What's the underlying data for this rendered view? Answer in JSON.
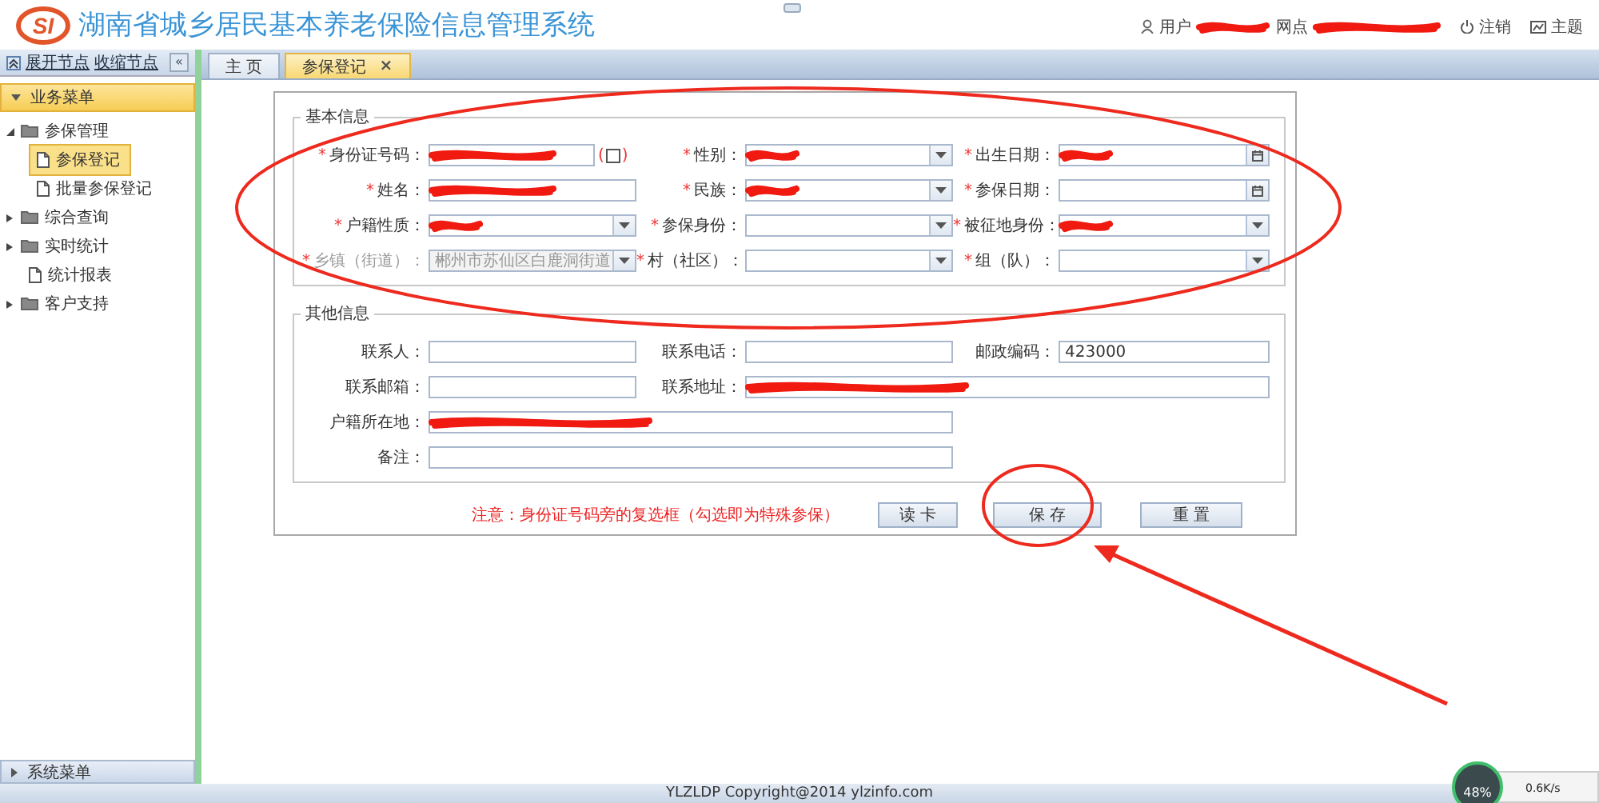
{
  "header": {
    "logo_text": "SI",
    "title": "湖南省城乡居民基本养老保险信息管理系统",
    "user_label": "用户",
    "user_redacted": true,
    "site_label": "网点",
    "site_redacted": true,
    "logout": "注销",
    "theme": "主题"
  },
  "sidebar": {
    "links": [
      "展开节点",
      "收缩节点"
    ],
    "collapse": "«",
    "section": "业务菜单",
    "tree": [
      {
        "label": "参保管理",
        "kind": "folder",
        "expanded": true,
        "children": [
          {
            "label": "参保登记",
            "kind": "page",
            "selected": true
          },
          {
            "label": "批量参保登记",
            "kind": "page",
            "selected": false
          }
        ]
      },
      {
        "label": "综合查询",
        "kind": "folder",
        "expanded": false
      },
      {
        "label": "实时统计",
        "kind": "folder",
        "expanded": false
      },
      {
        "label": "统计报表",
        "kind": "page",
        "selected": false
      },
      {
        "label": "客户支持",
        "kind": "folder",
        "expanded": false
      }
    ],
    "bottom": "系统菜单"
  },
  "tabs": [
    {
      "label": "主 页",
      "selected": false
    },
    {
      "label": "参保登记",
      "selected": true,
      "close": "×"
    }
  ],
  "sections": [
    {
      "legend": "基本信息",
      "rows": [
        [
          {
            "mark": "*",
            "label": "身份证号码：",
            "kind": "text",
            "redacted": true,
            "checkbox": {
              "open": "(",
              "close": ")",
              "checked": false
            }
          },
          {
            "mark": "*",
            "label": "性别：",
            "kind": "select",
            "redacted": true
          },
          {
            "mark": "*",
            "label": "出生日期：",
            "kind": "date",
            "redacted": true
          }
        ],
        [
          {
            "mark": "*",
            "label": "姓名：",
            "kind": "text",
            "redacted": true
          },
          {
            "mark": "*",
            "label": "民族：",
            "kind": "select",
            "redacted": true
          },
          {
            "mark": "*",
            "label": "参保日期：",
            "kind": "date"
          }
        ],
        [
          {
            "mark": "*",
            "label": "户籍性质：",
            "kind": "select",
            "redacted": true
          },
          {
            "mark": "*",
            "label": "参保身份：",
            "kind": "select"
          },
          {
            "mark": "*",
            "label": "被征地身份：",
            "kind": "select",
            "redacted": true
          }
        ],
        [
          {
            "mark": "*",
            "label": "乡镇（街道）：",
            "kind": "select",
            "value": "郴州市苏仙区白鹿洞街道",
            "disabled": true
          },
          {
            "mark": "*",
            "label": "村（社区）：",
            "kind": "select"
          },
          {
            "mark": "*",
            "label": "组（队）：",
            "kind": "select"
          }
        ]
      ]
    },
    {
      "legend": "其他信息",
      "rows": [
        [
          {
            "label": "联系人：",
            "kind": "text"
          },
          {
            "label": "联系电话：",
            "kind": "text"
          },
          {
            "label": "邮政编码：",
            "kind": "text",
            "value": "423000"
          }
        ],
        [
          {
            "label": "联系邮箱：",
            "kind": "text"
          },
          {
            "label": "联系地址：",
            "kind": "text",
            "wide": true,
            "redacted": true
          }
        ],
        [
          {
            "label": "户籍所在地：",
            "kind": "text",
            "wide": true,
            "redacted": true
          }
        ],
        [
          {
            "label": "备注：",
            "kind": "text",
            "wide": true
          }
        ]
      ]
    }
  ],
  "notice": "注意：身份证号码旁的复选框（勾选即为特殊参保）",
  "buttons": [
    "读 卡",
    "保 存",
    "重 置"
  ],
  "footer": "YLZLDP Copyright@2014 ylzinfo.com",
  "widget": {
    "percent": "48%",
    "speed": "0.6K/s"
  },
  "annotations": [
    {
      "kind": "ellipse"
    },
    {
      "kind": "ellipse"
    },
    {
      "kind": "arrow"
    }
  ]
}
